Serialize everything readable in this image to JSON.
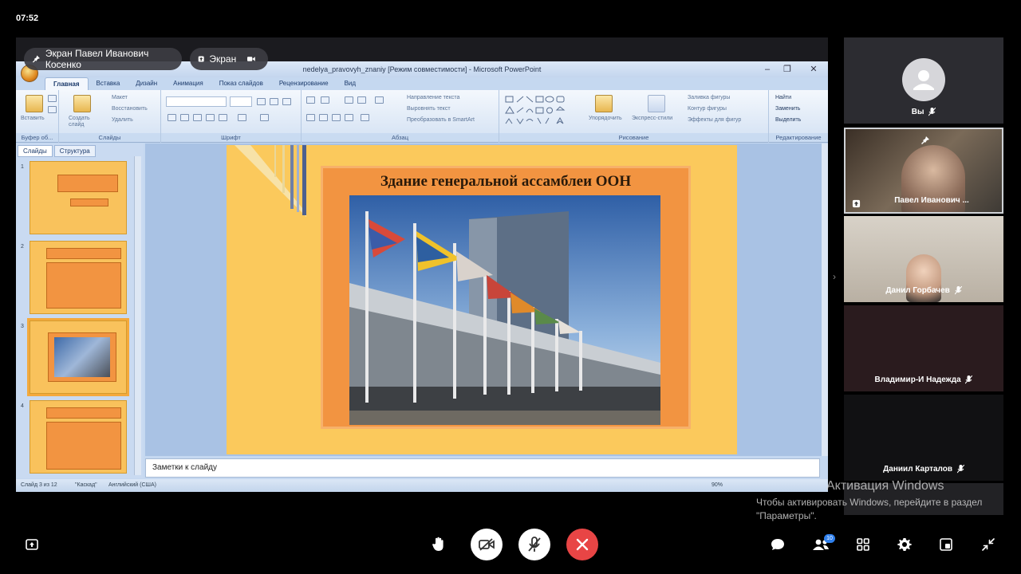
{
  "status_bar": {
    "time": "07:52"
  },
  "share": {
    "pin_label": "Экран Павел Иванович Косенко",
    "screen_label": "Экран"
  },
  "powerpoint": {
    "window_title": "nedelya_pravovyh_znaniy [Режим совместимости] - Microsoft PowerPoint",
    "tabs": [
      "Главная",
      "Вставка",
      "Дизайн",
      "Анимация",
      "Показ слайдов",
      "Рецензирование",
      "Вид"
    ],
    "ribbon": {
      "groups": [
        "Буфер об...",
        "Слайды",
        "Шрифт",
        "Абзац",
        "Рисование",
        "Редактирование"
      ],
      "paste": "Вставить",
      "new_slide": "Создать слайд",
      "layout": "Макет",
      "reset": "Восстановить",
      "delete": "Удалить",
      "text_dir": "Направление текста",
      "align_text": "Выровнять текст",
      "smartart": "Преобразовать в SmartArt",
      "arrange": "Упорядочить",
      "quick_styles": "Экспресс-стили",
      "fill": "Заливка фигуры",
      "outline": "Контур фигуры",
      "effects": "Эффекты для фигур",
      "find": "Найти",
      "replace": "Заменить",
      "select": "Выделить"
    },
    "panel_tabs": [
      "Слайды",
      "Структура"
    ],
    "thumbnails": [
      "1",
      "2",
      "3",
      "4"
    ],
    "slide": {
      "title": "Здание генеральной ассамблеи ООН"
    },
    "notes_placeholder": "Заметки к слайду",
    "status": {
      "slide": "Слайд 3 из 12",
      "theme": "\"Каскад\"",
      "language": "Английский (США)",
      "zoom": "90%"
    }
  },
  "participants": [
    {
      "name": "Вы",
      "muted": true
    },
    {
      "name": "Павел Иванович ...",
      "pinned": true
    },
    {
      "name": "Данил Горбачев",
      "muted": true
    },
    {
      "name": "Владимир-И Надежда",
      "muted": true
    },
    {
      "name": "Даниил Карталов",
      "muted": true
    }
  ],
  "watermark": {
    "title": "Активация Windows",
    "text": "Чтобы активировать Windows, перейдите в раздел \"Параметры\"."
  },
  "toolbar": {
    "participants_count": "10"
  },
  "colors": {
    "end_call": "#e84545",
    "badge": "#2f80ed",
    "slide_bg": "#fbc95c",
    "slide_panel": "#f29441"
  }
}
